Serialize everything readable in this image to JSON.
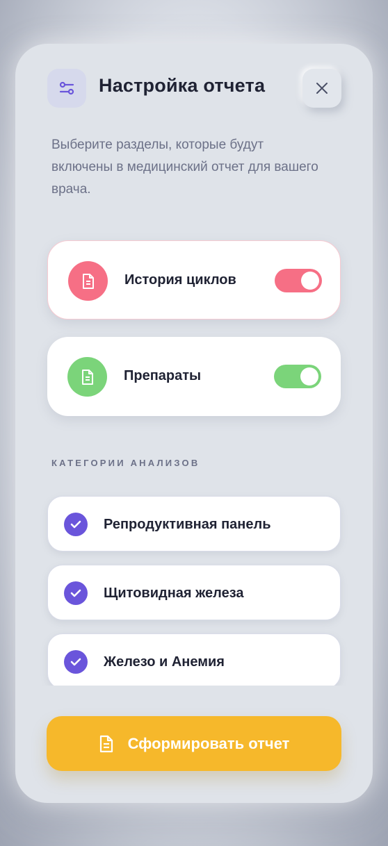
{
  "header": {
    "title": "Настройка отчета",
    "icon": "sliders-icon",
    "close_icon": "close-icon"
  },
  "description": "Выберите разделы, которые будут включены в медицинский отчет для вашего врача.",
  "sections": [
    {
      "label": "История циклов",
      "icon": "document-icon",
      "enabled": true,
      "color": "#f66f85"
    },
    {
      "label": "Препараты",
      "icon": "document-icon",
      "enabled": true,
      "color": "#7bd47a"
    }
  ],
  "analysis": {
    "heading": "КАТЕГОРИИ АНАЛИЗОВ",
    "items": [
      {
        "label": "Репродуктивная панель",
        "checked": true
      },
      {
        "label": "Щитовидная железа",
        "checked": true
      },
      {
        "label": "Железо и Анемия",
        "checked": true
      }
    ]
  },
  "cta": {
    "label": "Сформировать отчет",
    "icon": "document-icon"
  },
  "colors": {
    "accent": "#6a55db",
    "pink": "#f66f85",
    "green": "#7bd47a",
    "yellow": "#f6b82b"
  }
}
